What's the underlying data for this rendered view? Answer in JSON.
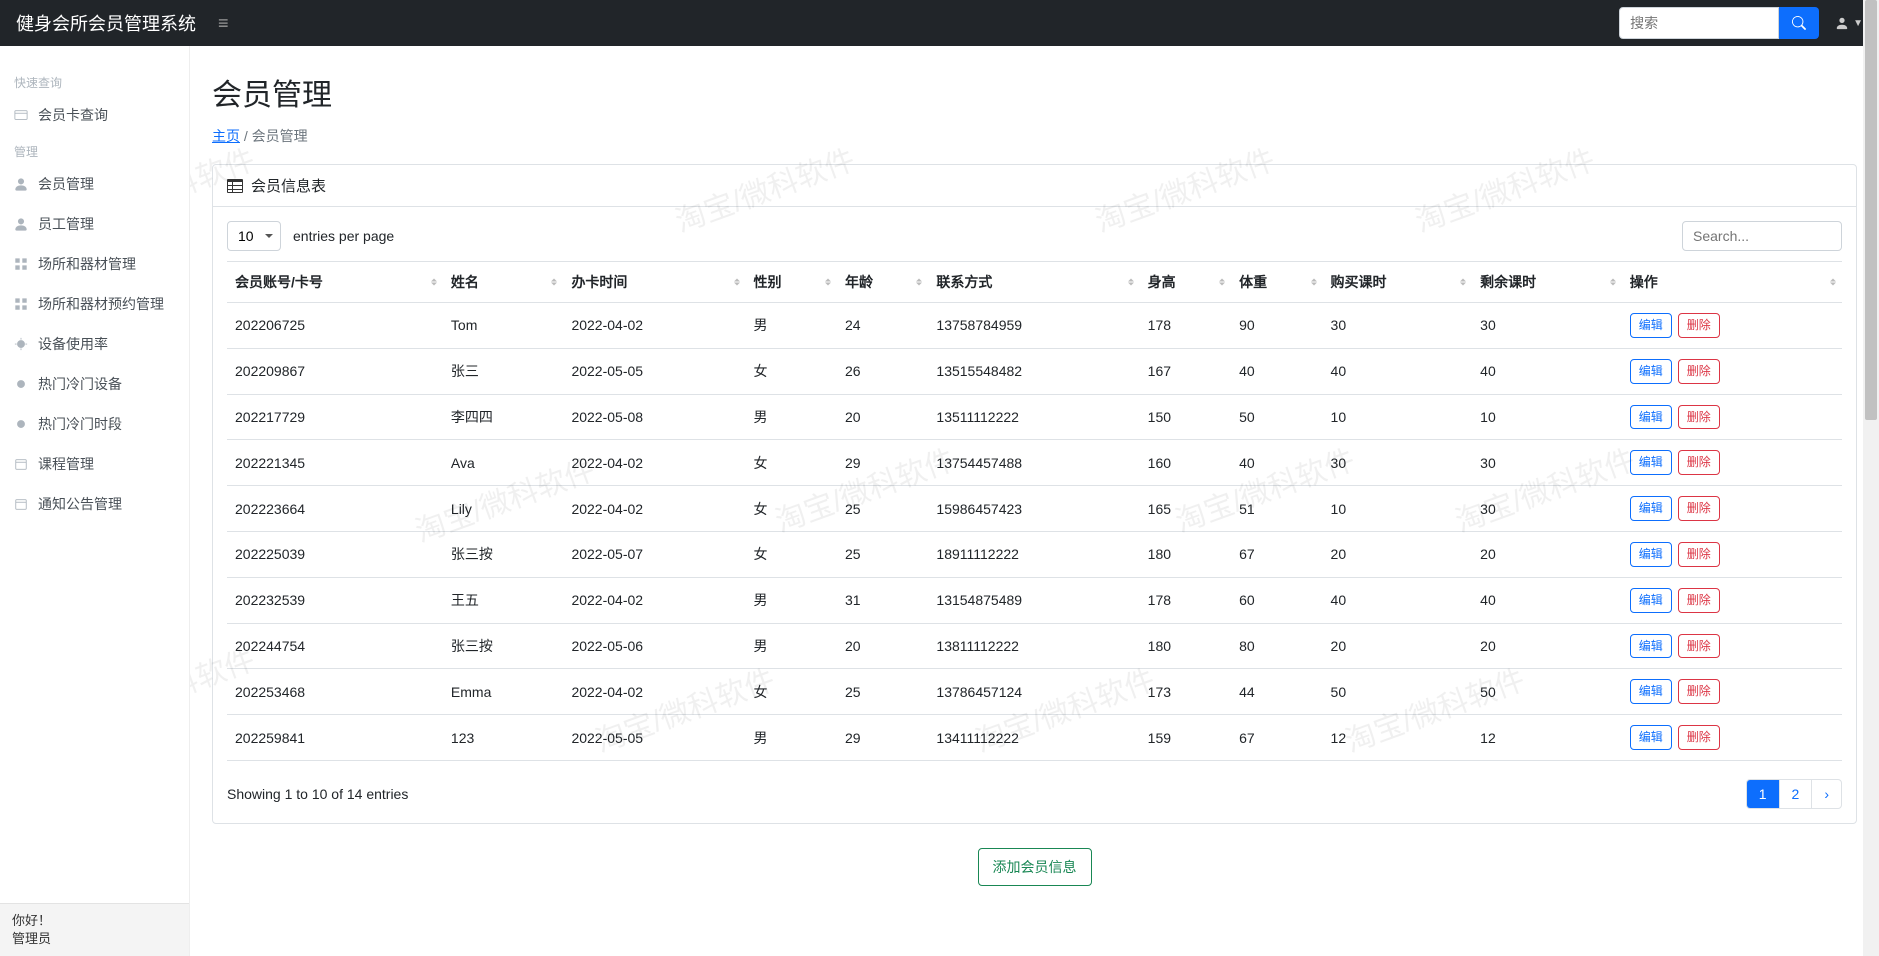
{
  "header": {
    "brand": "健身会所会员管理系统",
    "search_placeholder": "搜索"
  },
  "sidebar": {
    "section1": "快速查询",
    "item_query": "会员卡查询",
    "section2": "管理",
    "items": [
      "会员管理",
      "员工管理",
      "场所和器材管理",
      "场所和器材预约管理",
      "设备使用率",
      "热门冷门设备",
      "热门冷门时段",
      "课程管理",
      "通知公告管理"
    ],
    "footer_hello": "你好！",
    "footer_role": "管理员"
  },
  "page": {
    "title": "会员管理",
    "bc_home": "主页",
    "bc_current": "会员管理"
  },
  "card": {
    "title": "会员信息表"
  },
  "controls": {
    "page_size": "10",
    "entries_label": "entries per page",
    "search_placeholder": "Search..."
  },
  "columns": [
    "会员账号/卡号",
    "姓名",
    "办卡时间",
    "性别",
    "年龄",
    "联系方式",
    "身高",
    "体重",
    "购买课时",
    "剩余课时",
    "操作"
  ],
  "rows": [
    {
      "id": "202206725",
      "name": "Tom",
      "date": "2022-04-02",
      "gender": "男",
      "age": "24",
      "phone": "13758784959",
      "height": "178",
      "weight": "90",
      "buy": "30",
      "left": "30"
    },
    {
      "id": "202209867",
      "name": "张三",
      "date": "2022-05-05",
      "gender": "女",
      "age": "26",
      "phone": "13515548482",
      "height": "167",
      "weight": "40",
      "buy": "40",
      "left": "40"
    },
    {
      "id": "202217729",
      "name": "李四四",
      "date": "2022-05-08",
      "gender": "男",
      "age": "20",
      "phone": "13511112222",
      "height": "150",
      "weight": "50",
      "buy": "10",
      "left": "10"
    },
    {
      "id": "202221345",
      "name": "Ava",
      "date": "2022-04-02",
      "gender": "女",
      "age": "29",
      "phone": "13754457488",
      "height": "160",
      "weight": "40",
      "buy": "30",
      "left": "30"
    },
    {
      "id": "202223664",
      "name": "Lily",
      "date": "2022-04-02",
      "gender": "女",
      "age": "25",
      "phone": "15986457423",
      "height": "165",
      "weight": "51",
      "buy": "10",
      "left": "30"
    },
    {
      "id": "202225039",
      "name": "张三按",
      "date": "2022-05-07",
      "gender": "女",
      "age": "25",
      "phone": "18911112222",
      "height": "180",
      "weight": "67",
      "buy": "20",
      "left": "20"
    },
    {
      "id": "202232539",
      "name": "王五",
      "date": "2022-04-02",
      "gender": "男",
      "age": "31",
      "phone": "13154875489",
      "height": "178",
      "weight": "60",
      "buy": "40",
      "left": "40"
    },
    {
      "id": "202244754",
      "name": "张三按",
      "date": "2022-05-06",
      "gender": "男",
      "age": "20",
      "phone": "13811112222",
      "height": "180",
      "weight": "80",
      "buy": "20",
      "left": "20"
    },
    {
      "id": "202253468",
      "name": "Emma",
      "date": "2022-04-02",
      "gender": "女",
      "age": "25",
      "phone": "13786457124",
      "height": "173",
      "weight": "44",
      "buy": "50",
      "left": "50"
    },
    {
      "id": "202259841",
      "name": "123",
      "date": "2022-05-05",
      "gender": "男",
      "age": "29",
      "phone": "13411112222",
      "height": "159",
      "weight": "67",
      "buy": "12",
      "left": "12"
    }
  ],
  "actions": {
    "edit": "编辑",
    "del": "删除"
  },
  "footer": {
    "showing": "Showing 1 to 10 of 14 entries",
    "pages": [
      "1",
      "2",
      "›"
    ],
    "active": 0
  },
  "add_button": "添加会员信息",
  "watermark": "淘宝/微科软件"
}
